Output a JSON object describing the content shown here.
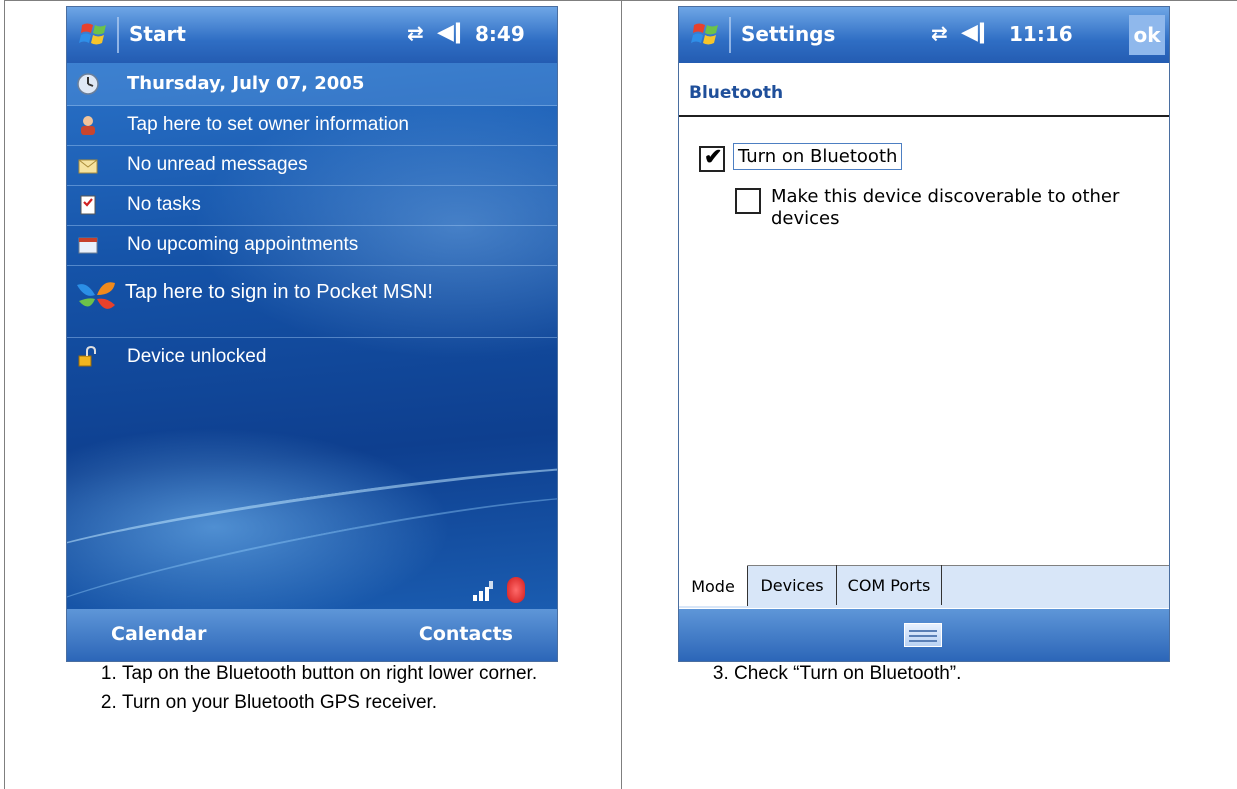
{
  "left_screen": {
    "titlebar": {
      "title": "Start",
      "clock": "8:49"
    },
    "today": {
      "date": "Thursday, July 07, 2005",
      "owner": "Tap here to set owner information",
      "messages": "No unread messages",
      "tasks": "No tasks",
      "appointments": "No upcoming appointments",
      "msn": "Tap here to sign in to Pocket MSN!",
      "lock": "Device unlocked"
    },
    "softkeys": {
      "left": "Calendar",
      "right": "Contacts"
    }
  },
  "right_screen": {
    "titlebar": {
      "title": "Settings",
      "clock": "11:16",
      "ok": "ok"
    },
    "header": "Bluetooth",
    "turn_on": {
      "label": "Turn on Bluetooth",
      "checked": true
    },
    "discoverable": {
      "label": "Make this device discoverable to other devices",
      "checked": false
    },
    "tabs": [
      "Mode",
      "Devices",
      "COM Ports"
    ]
  },
  "instructions": {
    "left": [
      "Tap on the Bluetooth button on right lower corner.",
      "Turn on your Bluetooth GPS receiver."
    ],
    "right": [
      "Check “Turn on Bluetooth”."
    ]
  },
  "colors": {
    "titlebar": "#2f6ec4",
    "today_bg": "#1553a8",
    "header_text": "#1f4f9a"
  }
}
